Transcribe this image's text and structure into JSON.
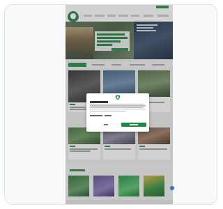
{
  "site": {
    "colors": {
      "brand": "#1e8a44",
      "dark_brand": "#1d7a3d",
      "overlay": "rgba(90,90,90,0.28)"
    },
    "crest_icon": "club-crest"
  },
  "cookie_dialog": {
    "logo_icon": "club-crest"
  },
  "chat": {
    "icon": "chat-bubble"
  }
}
